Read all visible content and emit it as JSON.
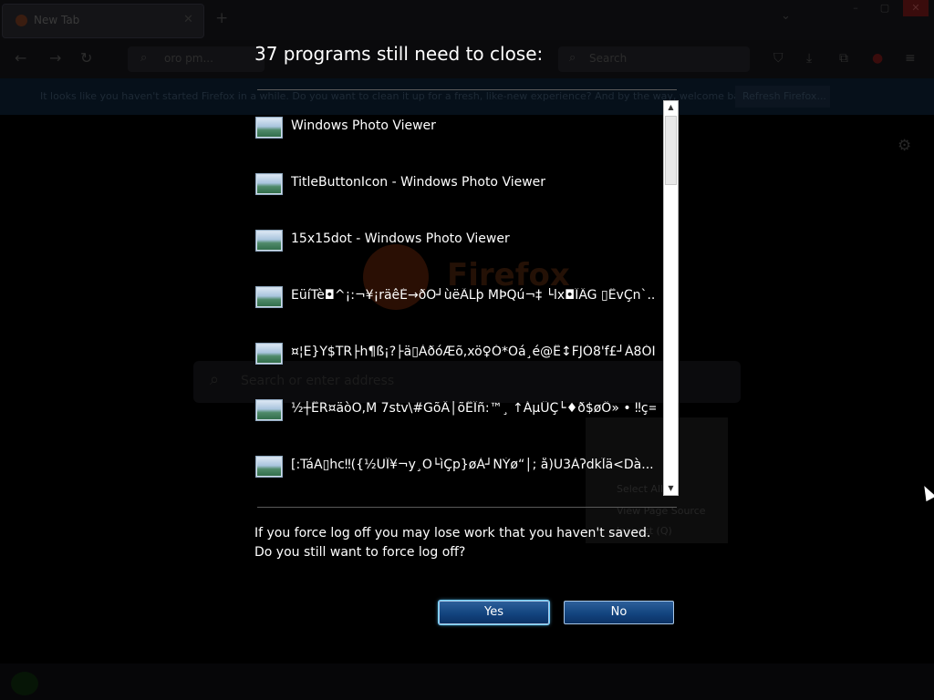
{
  "background": {
    "tab_title": "New Tab",
    "url_text": "oro pm...",
    "search_placeholder": "Search",
    "notice_text": "It looks like you haven't started Firefox in a while. Do you want to clean it up for a fresh, like-new experience? And by the way, welcome back!",
    "notice_button": "Refresh Firefox...",
    "logo_text": "Firefox",
    "big_search_placeholder": "Search or enter address",
    "context_menu": [
      "Select All",
      "View Page Source",
      "Inspect (Q)"
    ]
  },
  "dialog": {
    "title": "37 programs still need to close:",
    "programs": [
      "Windows Photo Viewer",
      "TitleButtonIcon - Windows Photo Viewer",
      "15x15dot - Windows Photo Viewer",
      "EüíTè◘^¡:¬¥¡räêÉ→ðÕ┘ùëÃLþ   MÞQú¬‡ └lx◘ÏÄG  ▯ËvÇn`...",
      "¤¦E}Y$TR├h¶ß¡?├ä▯ÀðóÆõ,xö♀Ó*Öá¸é@Ë↕FJÓ8'f£┘Á8ÓI...",
      "½┼ËR¤äòÖ,M 7stv\\#GõÄ│õËÎñ:™¸ ↑ÁµÛÇ└♦ð$øÔ» • ‼ç=...",
      "[:TáA▯hc‼({½ÜÏ¥¬y¸O└ìÇp}øÀ┘NÝø“│;   å)U3Àʔdkl̃ä<Dà..."
    ],
    "warning_line1": "If you force log off you may lose work that you haven't saved.",
    "warning_line2": "Do you still want to force log off?",
    "yes_label": "Yes",
    "no_label": "No"
  }
}
